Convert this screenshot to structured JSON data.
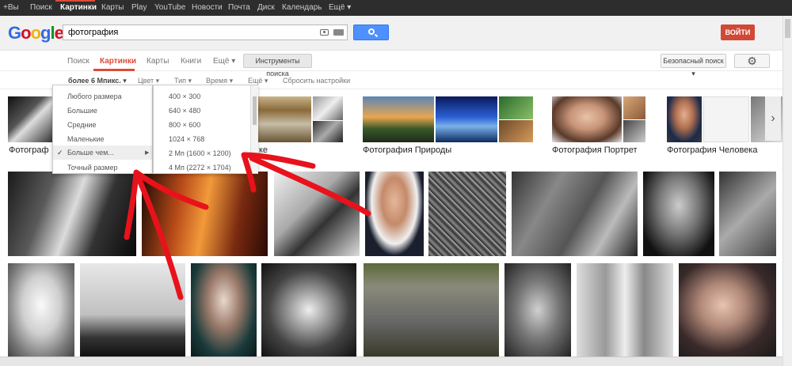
{
  "topbar": {
    "items": [
      "+Вы",
      "Поиск",
      "Картинки",
      "Карты",
      "Play",
      "YouTube",
      "Новости",
      "Почта",
      "Диск",
      "Календарь",
      "Ещё ▾"
    ],
    "active_index": 2
  },
  "header": {
    "logo": "Google",
    "query": "фотография",
    "login_label": "ВОЙТИ"
  },
  "nav": {
    "tabs": [
      "Поиск",
      "Картинки",
      "Карты",
      "Книги",
      "Ещё ▾"
    ],
    "active_index": 1,
    "tools_label": "Инструменты поиска",
    "safe_label": "Безопасный поиск ▾",
    "gear_icon": "gear-icon"
  },
  "toolsbar": {
    "size": "более 6 Мпикс. ▾",
    "color": "Цвет ▾",
    "type": "Тип ▾",
    "time": "Время ▾",
    "more": "Ещё ▾",
    "reset": "Сбросить настройки"
  },
  "size_menu": {
    "items": [
      "Любого размера",
      "Большие",
      "Средние",
      "Маленькие",
      "Больше чем...",
      "Точный размер"
    ],
    "checked_index": 4
  },
  "larger_menu": {
    "items": [
      "400 × 300",
      "640 × 480",
      "800 × 600",
      "1024 × 768",
      "2 Мп (1600 × 1200)",
      "4 Мп (2272 × 1704)"
    ]
  },
  "related": {
    "labels": [
      "Фотограф",
      "ке",
      "Фотография Природы",
      "Фотография Портрет",
      "Фотография Человека"
    ]
  },
  "colors": {
    "accent": "#dd4b39",
    "blue_button": "#4d90fe",
    "red_arrow": "#e8121c"
  }
}
